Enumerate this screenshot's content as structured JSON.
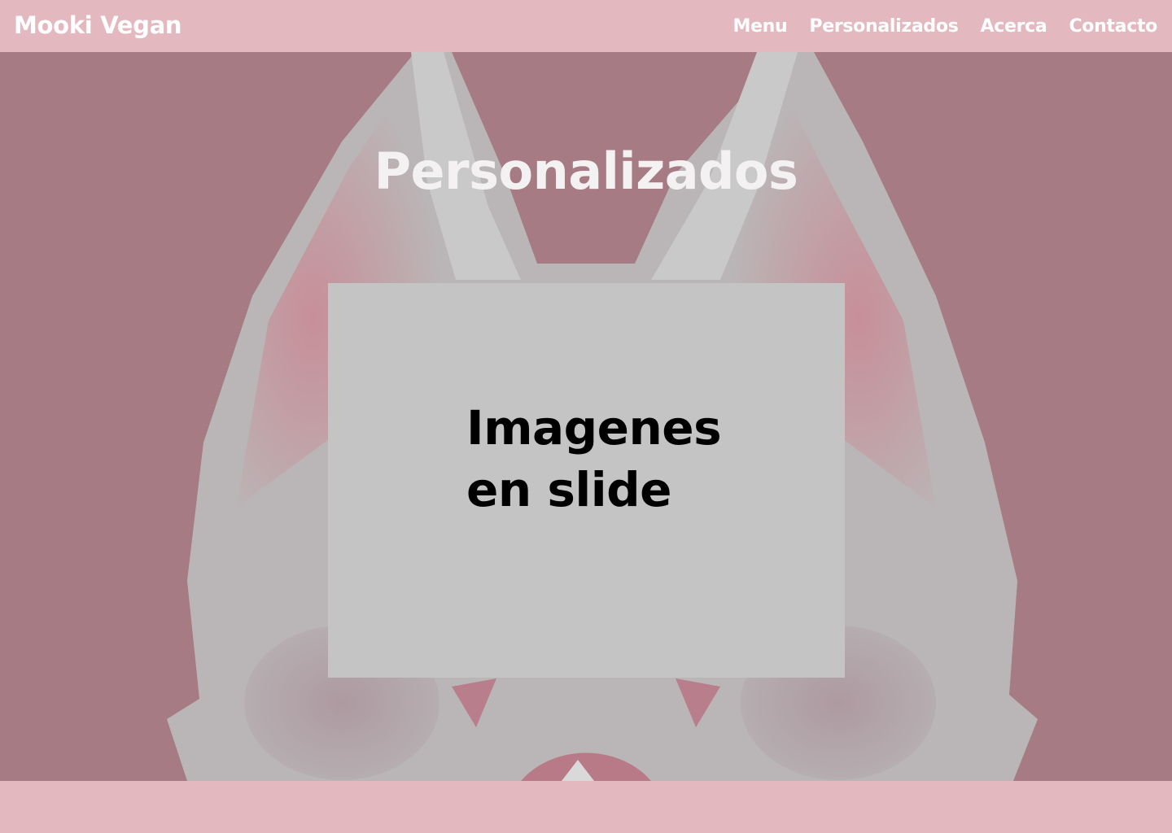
{
  "navbar": {
    "brand": "Mooki Vegan",
    "links": [
      {
        "label": "Menu"
      },
      {
        "label": "Personalizados"
      },
      {
        "label": "Acerca"
      },
      {
        "label": "Contacto"
      }
    ]
  },
  "hero": {
    "title": "Personalizados",
    "slide_placeholder": {
      "line1": "Imagenes",
      "line2": "en slide"
    },
    "background_art": "cat-face-illustration"
  },
  "colors": {
    "navbar_bg": "#e3b8bf",
    "hero_overlay": "#a67b83",
    "placeholder_bg": "#c4c4c4",
    "title_text": "#f4f1f2",
    "nav_text": "#ffffff"
  }
}
